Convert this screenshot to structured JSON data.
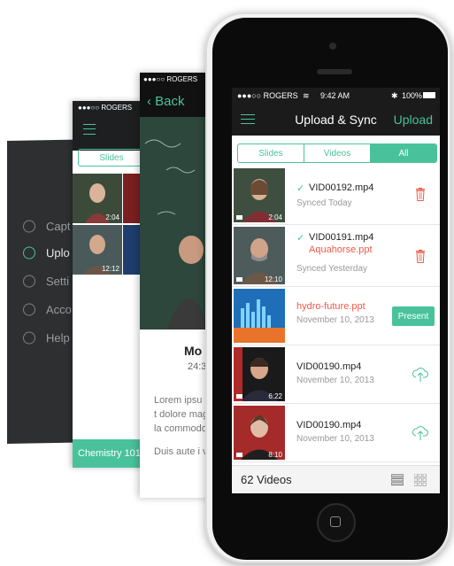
{
  "menu": {
    "items": [
      {
        "label": "Capt",
        "icon": "camera-icon"
      },
      {
        "label": "Uplo",
        "icon": "cloud-upload-icon"
      },
      {
        "label": "Setti",
        "icon": "settings-icon"
      },
      {
        "label": "Acco",
        "icon": "user-icon"
      },
      {
        "label": "Help",
        "icon": "help-icon"
      }
    ]
  },
  "grid_screen": {
    "status": "●●●○○ ROGERS",
    "tab_slides": "Slides",
    "times": [
      "2:04",
      "12:12"
    ],
    "footer": "Chemistry 101"
  },
  "detail_screen": {
    "status": "●●●○○ ROGERS",
    "back_label": "Back",
    "title": "Mo",
    "subtitle": "24:3",
    "para1": "Lorem ipsu consectetu eiusmod t dolore mag veniam, qu ullamco la commodo",
    "para2": "Duis aute i voluptate v"
  },
  "status_bar": {
    "carrier": "●●●○○ ROGERS",
    "time": "9:42 AM",
    "battery": "100%"
  },
  "nav": {
    "title": "Upload & Sync",
    "upload_label": "Upload"
  },
  "tabs": [
    "Slides",
    "Videos",
    "All"
  ],
  "rows": [
    {
      "title": "VID00192.mp4",
      "link": "",
      "status": "Synced Today",
      "thumb_time": "2:04",
      "action": "trash-icon"
    },
    {
      "title": "VID00191.mp4",
      "link": "Aquahorse.ppt",
      "status": "Synced Yesterday",
      "thumb_time": "12:10",
      "action": "trash-icon"
    },
    {
      "title": "",
      "link": "hydro-future.ppt",
      "status": "November 10, 2013",
      "thumb_time": "",
      "action": "Present"
    },
    {
      "title": "VID00190.mp4",
      "link": "",
      "status": "November 10, 2013",
      "thumb_time": "6:22",
      "action": "cloud-upload-icon"
    },
    {
      "title": "VID00190.mp4",
      "link": "",
      "status": "November 10, 2013",
      "thumb_time": "8:10",
      "action": "cloud-upload-icon"
    }
  ],
  "footer": {
    "count": "62 Videos"
  },
  "colors": {
    "accent": "#49c29b",
    "link": "#ef5a4a",
    "dark": "#1b1b1b"
  }
}
